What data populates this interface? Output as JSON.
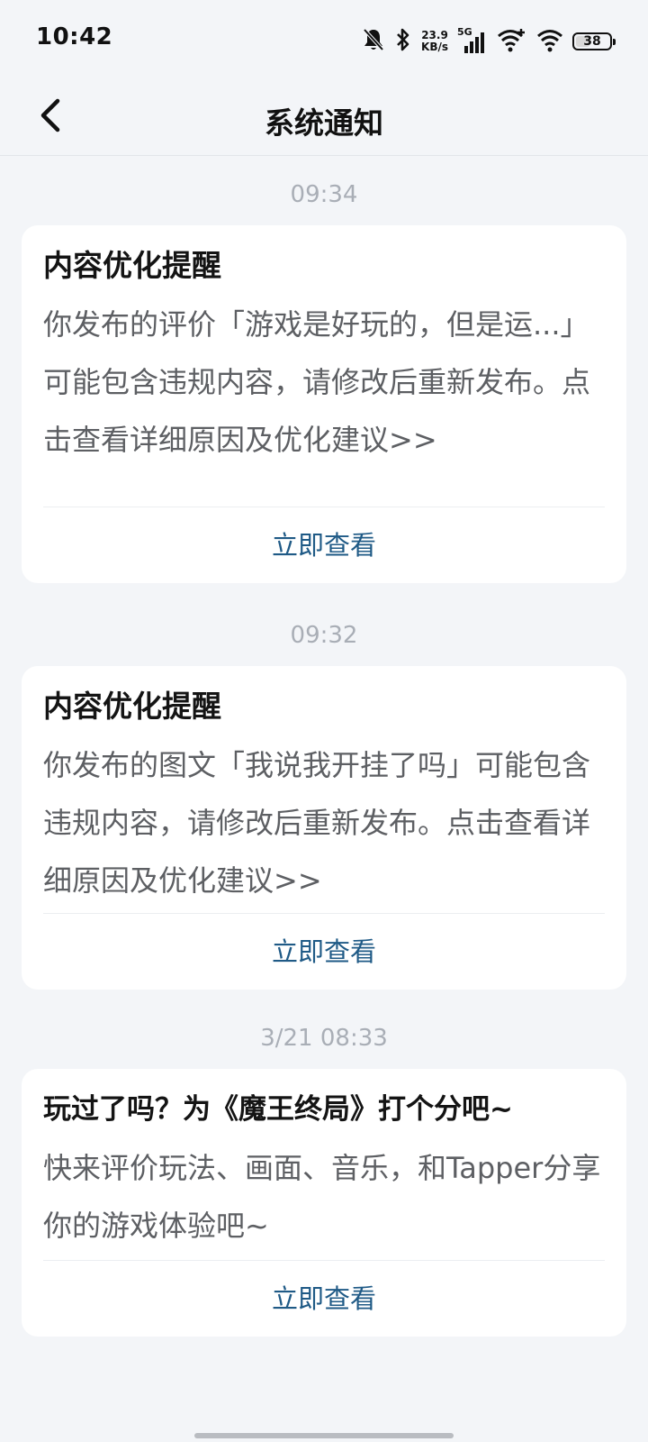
{
  "status_bar": {
    "time": "10:42",
    "net_speed_value": "23.9",
    "net_speed_unit": "KB/s",
    "network_type": "5G",
    "battery_level": "38",
    "icons": [
      "mute-bell-icon",
      "bluetooth-icon",
      "signal-icon",
      "wifi-plus-icon",
      "wifi-icon",
      "battery-icon"
    ]
  },
  "header": {
    "title": "系统通知",
    "back_icon": "chevron-left-icon"
  },
  "notifications": [
    {
      "time": "09:34",
      "title": "内容优化提醒",
      "body": "你发布的评价「游戏是好玩的，但是运...」可能包含违规内容，请修改后重新发布。点击查看详细原因及优化建议>>",
      "action_label": "立即查看"
    },
    {
      "time": "09:32",
      "title": "内容优化提醒",
      "body": "你发布的图文「我说我开挂了吗」可能包含违规内容，请修改后重新发布。点击查看详细原因及优化建议>>",
      "action_label": "立即查看"
    },
    {
      "time": "3/21  08:33",
      "title": "玩过了吗？为《魔王终局》打个分吧~",
      "body": "快来评价玩法、画面、音乐，和Tapper分享你的游戏体验吧~",
      "action_label": "立即查看"
    }
  ],
  "colors": {
    "background": "#f3f5f8",
    "card": "#ffffff",
    "time_label": "#a9aeb6",
    "body_text": "#5d5f63",
    "action": "#1f5a86"
  }
}
